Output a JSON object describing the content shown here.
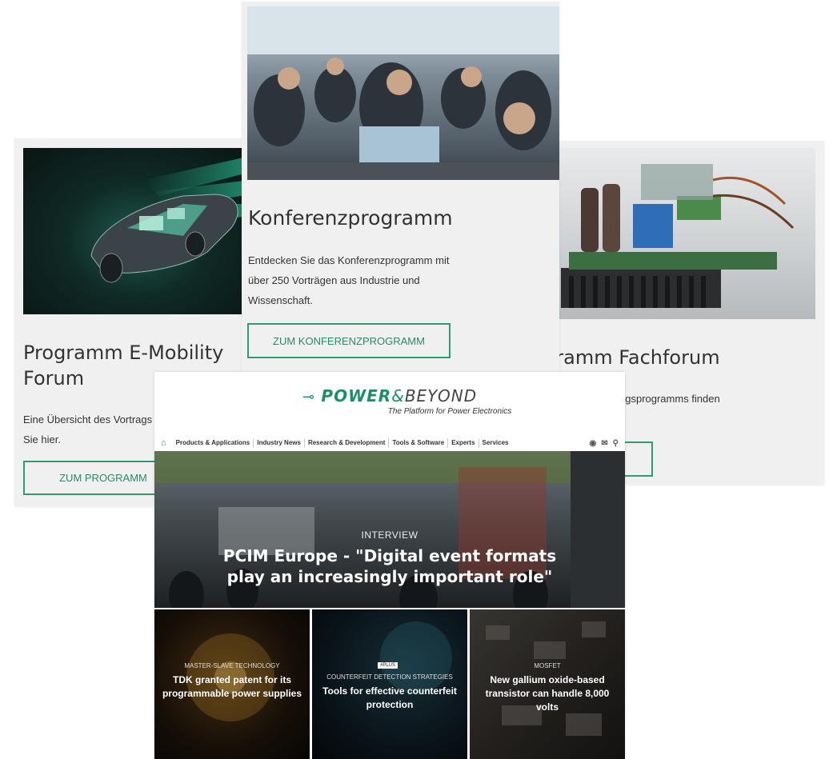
{
  "cards": {
    "left": {
      "title": "Programm E-Mobility Forum",
      "text": "Eine Übersicht des Vortrags Sie hier.",
      "button": "ZUM PROGRAMM"
    },
    "center": {
      "title": "Konferenzprogramm",
      "text": "Entdecken Sie das Konferenzprogramm mit über 250 Vorträgen aus Industrie und Wissenschaft.",
      "button": "ZUM KONFERENZPROGRAMM"
    },
    "right": {
      "title": "Programm Fachforum",
      "text": "agsprogramms finden"
    }
  },
  "site": {
    "logo_power": "POWER",
    "logo_amp": "&",
    "logo_beyond": "BEYOND",
    "tagline": "The Platform for Power Electronics",
    "nav": [
      "Products & Applications",
      "Industry News",
      "Research & Development",
      "Tools & Software",
      "Experts",
      "Services"
    ],
    "hero": {
      "kicker": "INTERVIEW",
      "title": "PCIM Europe - \"Digital event formats play an increasingly important role\""
    },
    "tiles": [
      {
        "kicker": "MASTER-SLAVE TECHNOLOGY",
        "title": "TDK granted patent for its programmable power supplies"
      },
      {
        "badge": "#PLUS",
        "kicker": "COUNTERFEIT DETECTION STRATEGIES",
        "title": "Tools for effective coun­terfeit protection"
      },
      {
        "kicker": "MOSFET",
        "title": "New gallium oxide-based transistor can handle 8,000 volts"
      }
    ]
  },
  "colors": {
    "accent": "#2e9e72",
    "card_bg": "#f0f0f0"
  }
}
